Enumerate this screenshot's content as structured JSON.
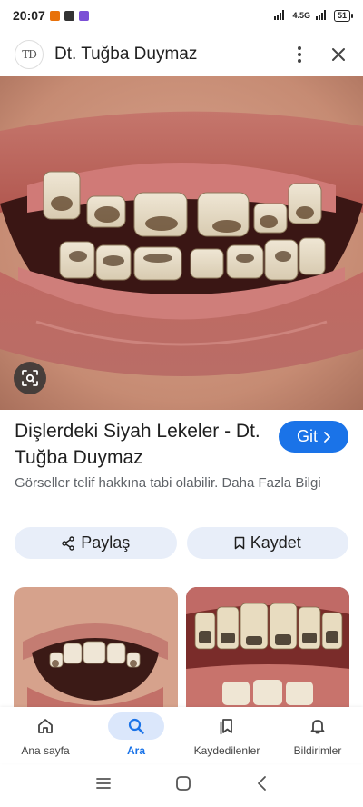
{
  "status_bar": {
    "time": "20:07",
    "network": "4.5G",
    "battery": "51"
  },
  "header": {
    "site_logo_text": "TD",
    "site_name": "Dt. Tuğba Duymaz"
  },
  "result": {
    "title": "Dişlerdeki Siyah Lekeler - Dt. Tuğba Duymaz",
    "visit_label": "Git",
    "copyright_notice": "Görseller telif hakkına tabi olabilir. Daha Fazla Bilgi"
  },
  "actions": {
    "share_label": "Paylaş",
    "save_label": "Kaydet"
  },
  "bottom_nav": {
    "items": [
      {
        "label": "Ana sayfa",
        "icon": "home-icon"
      },
      {
        "label": "Ara",
        "icon": "search-icon",
        "active": true
      },
      {
        "label": "Kaydedilenler",
        "icon": "bookmarks-icon"
      },
      {
        "label": "Bildirimler",
        "icon": "bell-icon"
      }
    ]
  },
  "colors": {
    "accent": "#1a73e8",
    "pill_bg": "#e8eef9",
    "active_nav_bg": "#dbe7fb"
  }
}
